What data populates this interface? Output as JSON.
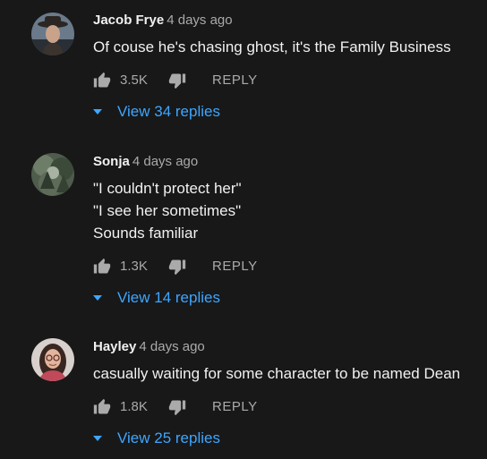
{
  "comments": [
    {
      "author": "Jacob Frye",
      "time": "4 days ago",
      "lines": [
        "Of couse he's chasing ghost, it's the Family Business"
      ],
      "likes": "3.5K",
      "reply_label": "REPLY",
      "view_replies": "View 34 replies",
      "avatar_icon": "man-with-hat-avatar"
    },
    {
      "author": "Sonja",
      "time": "4 days ago",
      "lines": [
        "\"I couldn't protect her\"",
        "\"I see her sometimes\"",
        "Sounds familiar"
      ],
      "likes": "1.3K",
      "reply_label": "REPLY",
      "view_replies": "View 14 replies",
      "avatar_icon": "forest-avatar"
    },
    {
      "author": "Hayley",
      "time": "4 days ago",
      "lines": [
        "casually waiting for some character to be named Dean"
      ],
      "likes": "1.8K",
      "reply_label": "REPLY",
      "view_replies": "View 25 replies",
      "avatar_icon": "woman-with-glasses-avatar"
    }
  ],
  "colors": {
    "background": "#181818",
    "text": "#f1f1f1",
    "secondary": "#aaaaaa",
    "link": "#3ea6ff"
  }
}
